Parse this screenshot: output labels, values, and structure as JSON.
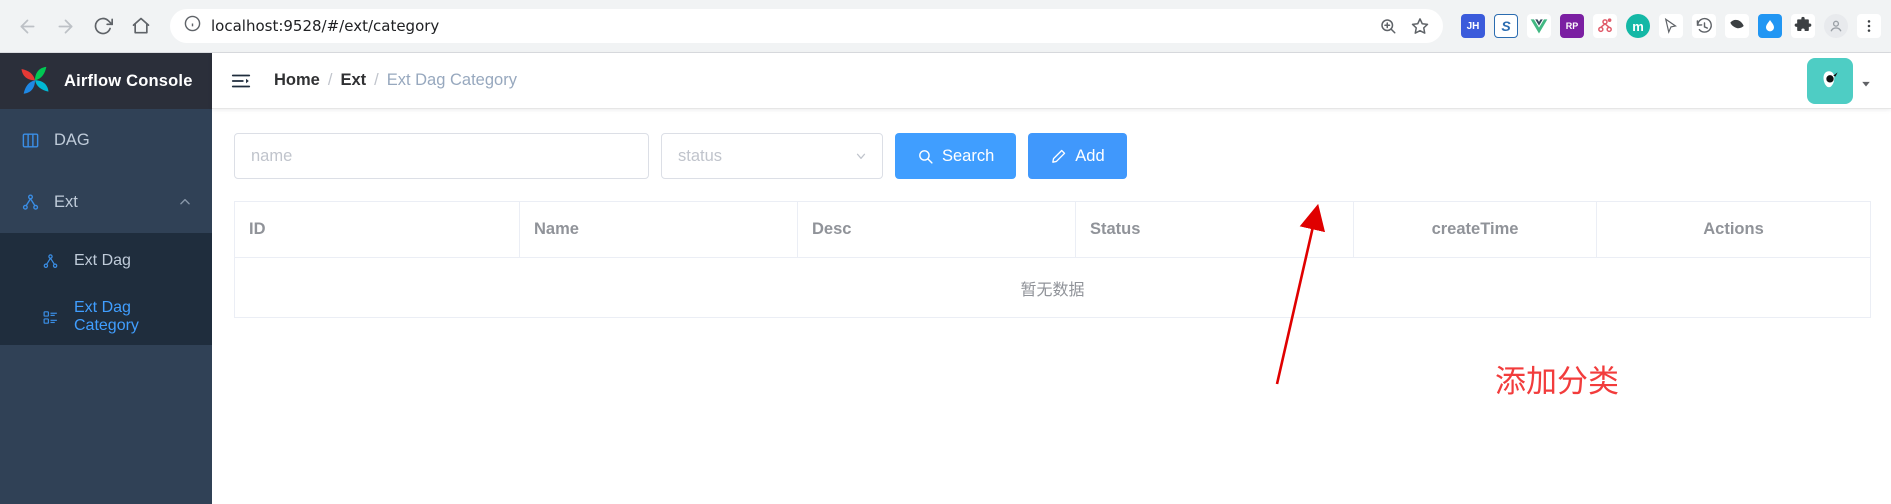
{
  "browser": {
    "url_prefix": "localhost:9528",
    "url_path": "/#/ext/category",
    "url_full": "localhost:9528/#/ext/category",
    "back_icon": "back-arrow-icon",
    "forward_icon": "forward-arrow-icon",
    "reload_icon": "reload-icon",
    "home_icon": "home-icon",
    "info_icon": "site-info-icon",
    "zoom_icon": "zoom-in-icon",
    "bookmark_icon": "star-icon",
    "extensions": [
      {
        "name": "jianguoyun-extension",
        "label": "JH",
        "bg": "#3b5bdb",
        "fg": "#ffffff"
      },
      {
        "name": "youdao-extension",
        "label": "S",
        "bg": "#ffffff",
        "fg": "#2b6cb0"
      },
      {
        "name": "vue-devtools-extension",
        "label": "V",
        "bg": "#ffffff",
        "fg": "#42b883"
      },
      {
        "name": "rp-extension",
        "label": "RP",
        "bg": "#7b1fa2",
        "fg": "#ffffff"
      },
      {
        "name": "network-extension",
        "label": "",
        "bg": "#ffffff",
        "fg": "#e05b6a"
      },
      {
        "name": "medium-extension",
        "label": "m",
        "bg": "#14b8a6",
        "fg": "#ffffff"
      },
      {
        "name": "cursor-extension",
        "label": "",
        "bg": "#ffffff",
        "fg": "#5f6368"
      },
      {
        "name": "history-extension",
        "label": "",
        "bg": "#ffffff",
        "fg": "#5f6368"
      },
      {
        "name": "pocket-extension",
        "label": "",
        "bg": "#ffffff",
        "fg": "#3c4043"
      },
      {
        "name": "drop-extension",
        "label": "",
        "bg": "#2196f3",
        "fg": "#ffffff"
      },
      {
        "name": "puzzle-extension",
        "label": "",
        "bg": "#ffffff",
        "fg": "#3c4043"
      },
      {
        "name": "profile-avatar",
        "label": "",
        "bg": "#e8eaed",
        "fg": "#5f6368"
      },
      {
        "name": "chrome-menu",
        "label": "",
        "bg": "#ffffff",
        "fg": "#3c4043"
      }
    ]
  },
  "sidebar": {
    "brand": "Airflow Console",
    "items": [
      {
        "label": "DAG",
        "icon": "dashboard-icon",
        "active": false,
        "expandable": false
      },
      {
        "label": "Ext",
        "icon": "share-nodes-icon",
        "active": false,
        "expandable": true
      }
    ],
    "submenu": [
      {
        "label": "Ext Dag",
        "icon": "share-nodes-icon",
        "active": false
      },
      {
        "label": "Ext Dag Category",
        "icon": "list-icon",
        "active": true
      }
    ]
  },
  "navbar": {
    "collapse_icon": "hamburger-collapse-icon",
    "breadcrumb": [
      "Home",
      "Ext",
      "Ext Dag Category"
    ],
    "separator": "/",
    "avatar_icon": "user-avatar",
    "caret_icon": "chevron-down-icon"
  },
  "filters": {
    "name_placeholder": "name",
    "name_value": "",
    "status_placeholder": "status",
    "status_value": "",
    "status_caret": "chevron-down-icon",
    "search_label": "Search",
    "search_icon": "search-icon",
    "add_label": "Add",
    "add_icon": "edit-pencil-icon"
  },
  "table": {
    "columns": [
      "ID",
      "Name",
      "Desc",
      "Status",
      "createTime",
      "Actions"
    ],
    "rows": [],
    "empty_text": "暂无数据"
  },
  "annotation": {
    "text": "添加分类",
    "color": "#f23c3c",
    "arrow_icon": "red-arrow-pointer"
  },
  "colors": {
    "sidebar_bg": "#304156",
    "sidebar_sub_bg": "#1f2d3d",
    "brand_bg": "#2b2f3a",
    "accent": "#409eff",
    "active_text": "#409eff"
  }
}
